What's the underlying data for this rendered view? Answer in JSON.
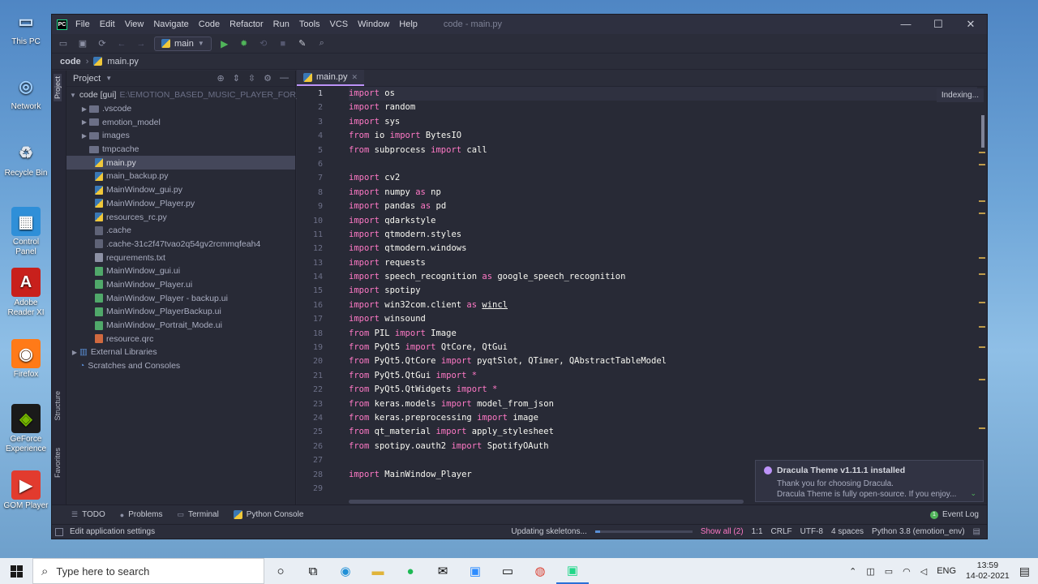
{
  "desktop": {
    "icons": [
      {
        "label": "This PC",
        "glyph": "computer-icon"
      },
      {
        "label": "Network",
        "glyph": "network-icon"
      },
      {
        "label": "Recycle Bin",
        "glyph": "recycle-bin-icon"
      },
      {
        "label": "Control Panel",
        "glyph": "control-panel-icon"
      },
      {
        "label": "Adobe Reader XI",
        "glyph": "adobe-reader-icon"
      },
      {
        "label": "Firefox",
        "glyph": "firefox-icon"
      },
      {
        "label": "GeForce Experience",
        "glyph": "geforce-icon"
      },
      {
        "label": "GOM Player",
        "glyph": "gom-player-icon"
      }
    ]
  },
  "window": {
    "menu": [
      "File",
      "Edit",
      "View",
      "Navigate",
      "Code",
      "Refactor",
      "Run",
      "Tools",
      "VCS",
      "Window",
      "Help"
    ],
    "title": "code - main.py",
    "controls": {
      "minimize": "—",
      "maximize": "☐",
      "close": "✕"
    }
  },
  "toolbar": {
    "run_config": "main"
  },
  "breadcrumb": {
    "root": "code",
    "file": "main.py"
  },
  "stripes": {
    "project": "Project",
    "structure": "Structure",
    "favorites": "Favorites"
  },
  "project_panel": {
    "title": "Project",
    "root_name": "code [gui]",
    "root_path": "E:\\EMOTION_BASED_MUSIC_PLAYER_FOR_BL",
    "items": [
      {
        "label": ".vscode",
        "type": "folder"
      },
      {
        "label": "emotion_model",
        "type": "folder"
      },
      {
        "label": "images",
        "type": "folder"
      },
      {
        "label": "tmpcache",
        "type": "folder"
      },
      {
        "label": "main.py",
        "type": "py",
        "selected": true
      },
      {
        "label": "main_backup.py",
        "type": "py"
      },
      {
        "label": "MainWindow_gui.py",
        "type": "py"
      },
      {
        "label": "MainWindow_Player.py",
        "type": "py"
      },
      {
        "label": "resources_rc.py",
        "type": "py"
      },
      {
        "label": ".cache",
        "type": "cache"
      },
      {
        "label": ".cache-31c2f47tvao2q54gv2rcmmqfeah4",
        "type": "cache"
      },
      {
        "label": "requrements.txt",
        "type": "txt"
      },
      {
        "label": "MainWindow_gui.ui",
        "type": "ui"
      },
      {
        "label": "MainWindow_Player.ui",
        "type": "ui"
      },
      {
        "label": "MainWindow_Player - backup.ui",
        "type": "ui"
      },
      {
        "label": "MainWindow_PlayerBackup.ui",
        "type": "ui"
      },
      {
        "label": "MainWindow_Portrait_Mode.ui",
        "type": "ui"
      },
      {
        "label": "resource.qrc",
        "type": "qrc"
      }
    ],
    "external_libraries": "External Libraries",
    "scratches": "Scratches and Consoles"
  },
  "editor": {
    "tab": "main.py",
    "indexing": "Indexing...",
    "lines": [
      {
        "n": "1",
        "segs": [
          [
            "kw",
            "import"
          ],
          [
            "",
            " os"
          ]
        ]
      },
      {
        "n": "2",
        "segs": [
          [
            "kw",
            "import"
          ],
          [
            "",
            " random"
          ]
        ]
      },
      {
        "n": "3",
        "segs": [
          [
            "kw",
            "import"
          ],
          [
            "",
            " sys"
          ]
        ]
      },
      {
        "n": "4",
        "segs": [
          [
            "kw",
            "from"
          ],
          [
            "",
            " io "
          ],
          [
            "kw",
            "import"
          ],
          [
            "",
            " BytesIO"
          ]
        ]
      },
      {
        "n": "5",
        "segs": [
          [
            "kw",
            "from"
          ],
          [
            "",
            " subprocess "
          ],
          [
            "kw",
            "import"
          ],
          [
            "",
            " call"
          ]
        ]
      },
      {
        "n": "6",
        "segs": []
      },
      {
        "n": "7",
        "segs": [
          [
            "kw",
            "import"
          ],
          [
            "",
            " cv2"
          ]
        ]
      },
      {
        "n": "8",
        "segs": [
          [
            "kw",
            "import"
          ],
          [
            "",
            " numpy "
          ],
          [
            "kw",
            "as"
          ],
          [
            "",
            " np"
          ]
        ]
      },
      {
        "n": "9",
        "segs": [
          [
            "kw",
            "import"
          ],
          [
            "",
            " pandas "
          ],
          [
            "kw",
            "as"
          ],
          [
            "",
            " pd"
          ]
        ]
      },
      {
        "n": "10",
        "segs": [
          [
            "kw",
            "import"
          ],
          [
            "",
            " qdarkstyle"
          ]
        ]
      },
      {
        "n": "11",
        "segs": [
          [
            "kw",
            "import"
          ],
          [
            "",
            " qtmodern.styles"
          ]
        ]
      },
      {
        "n": "12",
        "segs": [
          [
            "kw",
            "import"
          ],
          [
            "",
            " qtmodern.windows"
          ]
        ]
      },
      {
        "n": "13",
        "segs": [
          [
            "kw",
            "import"
          ],
          [
            "",
            " requests"
          ]
        ]
      },
      {
        "n": "14",
        "segs": [
          [
            "kw",
            "import"
          ],
          [
            "",
            " speech_recognition "
          ],
          [
            "kw",
            "as"
          ],
          [
            "",
            " google_speech_recognition"
          ]
        ]
      },
      {
        "n": "15",
        "segs": [
          [
            "kw",
            "import"
          ],
          [
            "",
            " spotipy"
          ]
        ]
      },
      {
        "n": "16",
        "segs": [
          [
            "kw",
            "import"
          ],
          [
            "",
            " win32com.client "
          ],
          [
            "kw",
            "as"
          ],
          [
            "",
            " "
          ],
          [
            "ul",
            "wincl"
          ]
        ]
      },
      {
        "n": "17",
        "segs": [
          [
            "kw",
            "import"
          ],
          [
            "",
            " winsound"
          ]
        ]
      },
      {
        "n": "18",
        "segs": [
          [
            "kw",
            "from"
          ],
          [
            "",
            " PIL "
          ],
          [
            "kw",
            "import"
          ],
          [
            "",
            " Image"
          ]
        ]
      },
      {
        "n": "19",
        "segs": [
          [
            "kw",
            "from"
          ],
          [
            "",
            " PyQt5 "
          ],
          [
            "kw",
            "import"
          ],
          [
            "",
            " QtCore, QtGui"
          ]
        ]
      },
      {
        "n": "20",
        "segs": [
          [
            "kw",
            "from"
          ],
          [
            "",
            " PyQt5.QtCore "
          ],
          [
            "kw",
            "import"
          ],
          [
            "",
            " pyqtSlot, QTimer, QAbstractTableModel"
          ]
        ]
      },
      {
        "n": "21",
        "segs": [
          [
            "kw",
            "from"
          ],
          [
            "",
            " PyQt5.QtGui "
          ],
          [
            "kw",
            "import"
          ],
          [
            "kw",
            " *"
          ]
        ]
      },
      {
        "n": "22",
        "segs": [
          [
            "kw",
            "from"
          ],
          [
            "",
            " PyQt5.QtWidgets "
          ],
          [
            "kw",
            "import"
          ],
          [
            "kw",
            " *"
          ]
        ]
      },
      {
        "n": "23",
        "segs": [
          [
            "kw",
            "from"
          ],
          [
            "",
            " keras.models "
          ],
          [
            "kw",
            "import"
          ],
          [
            "",
            " model_from_json"
          ]
        ]
      },
      {
        "n": "24",
        "segs": [
          [
            "kw",
            "from"
          ],
          [
            "",
            " keras.preprocessing "
          ],
          [
            "kw",
            "import"
          ],
          [
            "",
            " image"
          ]
        ]
      },
      {
        "n": "25",
        "segs": [
          [
            "kw",
            "from"
          ],
          [
            "",
            " qt_material "
          ],
          [
            "kw",
            "import"
          ],
          [
            "",
            " apply_stylesheet"
          ]
        ]
      },
      {
        "n": "26",
        "segs": [
          [
            "kw",
            "from"
          ],
          [
            "",
            " spotipy.oauth2 "
          ],
          [
            "kw",
            "import"
          ],
          [
            "",
            " SpotifyOAuth"
          ]
        ]
      },
      {
        "n": "27",
        "segs": []
      },
      {
        "n": "28",
        "segs": [
          [
            "kw",
            "import"
          ],
          [
            "",
            " MainWindow_Player"
          ]
        ]
      },
      {
        "n": "29",
        "segs": []
      }
    ]
  },
  "notification": {
    "title": "Dracula Theme v1.11.1 installed",
    "line1": "Thank you for choosing Dracula.",
    "line2": "Dracula Theme is fully open-source. If you enjoy..."
  },
  "tool_windows": {
    "todo": "TODO",
    "problems": "Problems",
    "terminal": "Terminal",
    "python_console": "Python Console",
    "event_log": "Event Log",
    "event_count": "1"
  },
  "status": {
    "hint": "Edit application settings",
    "progress_text": "Updating skeletons...",
    "progress_fraction": 0.05,
    "show_all": "Show all (2)",
    "position": "1:1",
    "line_sep": "CRLF",
    "encoding": "UTF-8",
    "indent": "4 spaces",
    "interpreter": "Python 3.8 (emotion_env)"
  },
  "taskbar": {
    "search_placeholder": "Type here to search",
    "lang": "ENG",
    "time": "13:59",
    "date": "14-02-2021"
  }
}
